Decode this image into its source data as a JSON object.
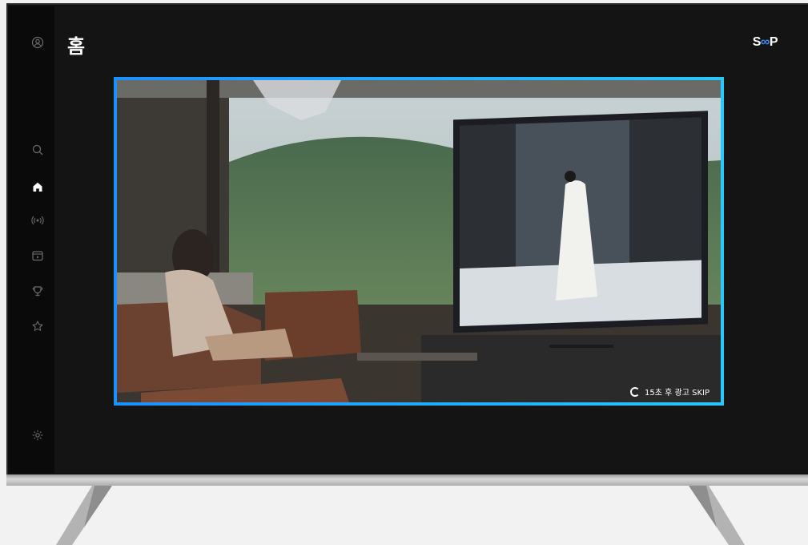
{
  "page": {
    "title": "홈",
    "brand_prefix": "S",
    "brand_mid": "∞",
    "brand_suffix": "P"
  },
  "sidebar": {
    "items": [
      {
        "icon": "profile-icon"
      },
      {
        "icon": "search-icon"
      },
      {
        "icon": "home-icon",
        "active": true
      },
      {
        "icon": "live-broadcast-icon"
      },
      {
        "icon": "vod-icon"
      },
      {
        "icon": "esports-trophy-icon"
      },
      {
        "icon": "star-icon"
      },
      {
        "icon": "settings-icon"
      }
    ]
  },
  "player": {
    "skip_label": "15초 후 광고 SKIP"
  },
  "colors": {
    "accent": "#1fa2ff",
    "accent_end": "#27c7ff",
    "screen_bg": "#141414"
  }
}
